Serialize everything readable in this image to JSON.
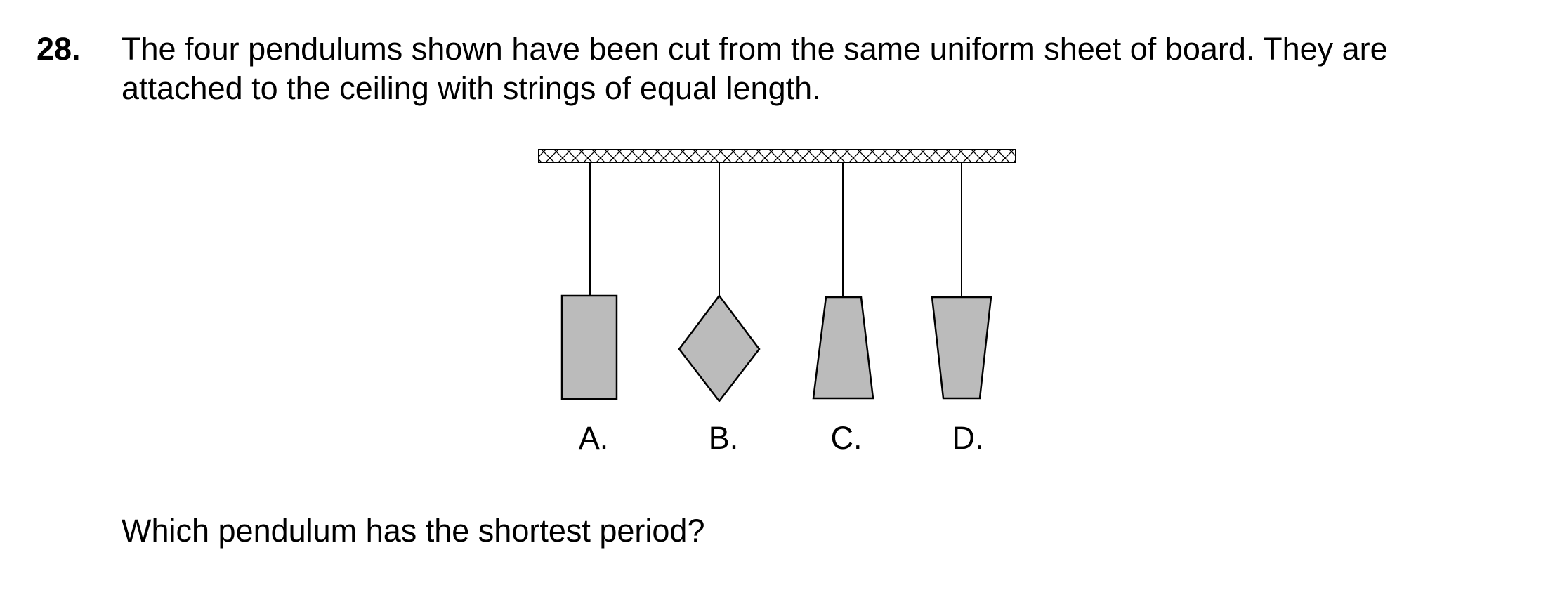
{
  "question": {
    "number": "28.",
    "text": "The four pendulums shown have been cut from the same uniform sheet of board. They are attached to the ceiling with strings of equal length.",
    "prompt": "Which pendulum has the shortest period?"
  },
  "options": [
    {
      "label": "A.",
      "shape": "rectangle"
    },
    {
      "label": "B.",
      "shape": "diamond"
    },
    {
      "label": "C.",
      "shape": "trapezoid-wide-bottom"
    },
    {
      "label": "D.",
      "shape": "trapezoid-wide-top"
    }
  ],
  "colors": {
    "bob_fill": "#bbbbbb",
    "line": "#000000",
    "background": "#ffffff"
  }
}
